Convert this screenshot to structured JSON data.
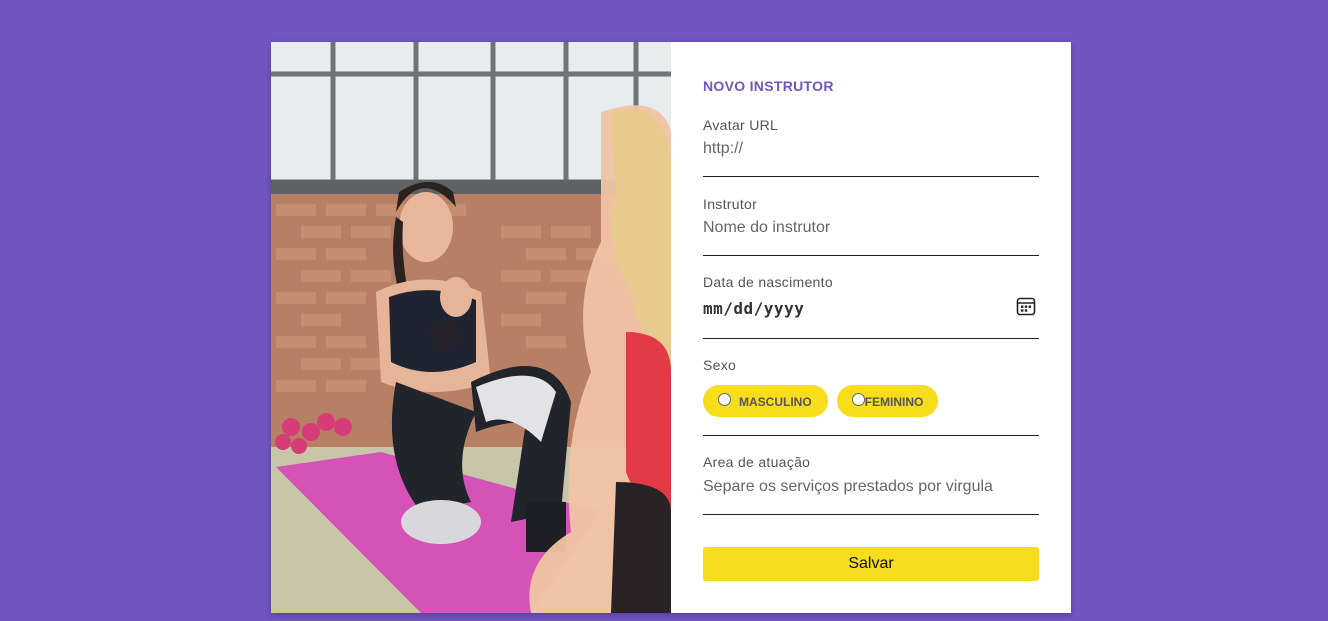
{
  "form": {
    "title": "NOVO INSTRUTOR",
    "avatar": {
      "label": "Avatar URL",
      "placeholder": "http://"
    },
    "instrutor": {
      "label": "Instrutor",
      "placeholder": "Nome do instrutor"
    },
    "nascimento": {
      "label": "Data de nascimento",
      "value": "mm/dd/yyyy",
      "icon": "calendar-icon"
    },
    "sexo": {
      "label": "Sexo",
      "options": [
        {
          "label": "MASCULINO",
          "checked": false
        },
        {
          "label": "FEMININO",
          "checked": false
        }
      ]
    },
    "area": {
      "label": "Area de atuação",
      "placeholder": "Separe os serviços prestados por virgula"
    },
    "save_label": "Salvar"
  },
  "colors": {
    "background": "#7156c1",
    "accent": "#7156c1",
    "button": "#f5dc1c"
  }
}
